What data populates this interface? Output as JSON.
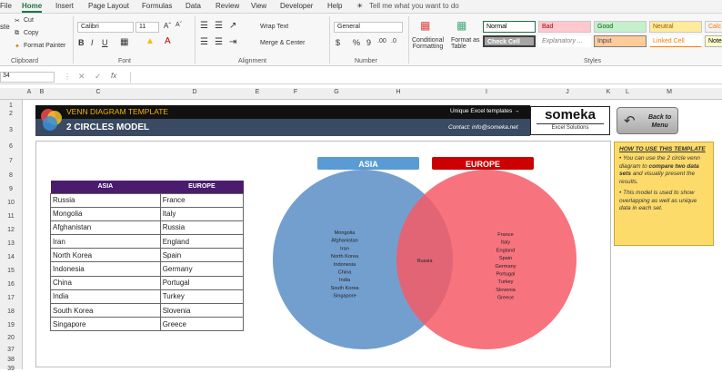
{
  "ribbon": {
    "tabs": [
      "File",
      "Home",
      "Insert",
      "Page Layout",
      "Formulas",
      "Data",
      "Review",
      "View",
      "Developer",
      "Help"
    ],
    "tell_me": "Tell me what you want to do",
    "clipboard": {
      "cut": "Cut",
      "copy": "Copy",
      "format_painter": "Format Painter",
      "paste": "ste",
      "label": "Clipboard"
    },
    "font": {
      "name": "Calibri",
      "size": "11",
      "label": "Font"
    },
    "alignment": {
      "wrap": "Wrap Text",
      "merge": "Merge & Center",
      "label": "Alignment"
    },
    "number": {
      "format": "General",
      "label": "Number"
    },
    "styles": {
      "conditional": "Conditional\nFormatting",
      "format_as": "Format as\nTable",
      "label": "Styles",
      "cells": [
        {
          "label": "Normal",
          "bg": "#ffffff",
          "fg": "#000000"
        },
        {
          "label": "Bad",
          "bg": "#ffc7ce",
          "fg": "#9c0006"
        },
        {
          "label": "Good",
          "bg": "#c6efce",
          "fg": "#006100"
        },
        {
          "label": "Neutral",
          "bg": "#ffeb9c",
          "fg": "#9c5700"
        },
        {
          "label": "Calc",
          "bg": "#f2f2f2",
          "fg": "#fa7d00"
        },
        {
          "label": "Check Cell",
          "bg": "#a5a5a5",
          "fg": "#ffffff"
        },
        {
          "label": "Explanatory ...",
          "bg": "#ffffff",
          "fg": "#7f7f7f"
        },
        {
          "label": "Input",
          "bg": "#ffcc99",
          "fg": "#3f3f76"
        },
        {
          "label": "Linked Cell",
          "bg": "#ffffff",
          "fg": "#fa7d00"
        },
        {
          "label": "Note",
          "bg": "#ffffcc",
          "fg": "#000000"
        }
      ]
    }
  },
  "formula_bar": {
    "name_box": "34",
    "value": ""
  },
  "columns": [
    "A",
    "B",
    "C",
    "D",
    "E",
    "F",
    "G",
    "H",
    "I",
    "J",
    "K",
    "L",
    "M"
  ],
  "rows": [
    "1",
    "2",
    "3",
    "6",
    "7",
    "8",
    "9",
    "10",
    "11",
    "12",
    "13",
    "14",
    "15",
    "16",
    "17",
    "18",
    "19",
    "20",
    "37",
    "38",
    "39"
  ],
  "banner": {
    "title": "VENN DIAGRAM TEMPLATE",
    "subtitle": "2 CIRCLES MODEL",
    "unique": "Unique Excel templates →",
    "contact": "Contact: info@someka.net",
    "logo_name": "someka",
    "logo_sub": "Excel Solutions",
    "back": "Back to\nMenu"
  },
  "howto": {
    "title": "HOW TO USE THIS TEMPLATE",
    "p1a": "You can use the 2 circle venn diagram to ",
    "p1b": "compare two data sets",
    "p1c": " and visually present the results.",
    "p2": "This model is used to show overlapping as well as unique data in each set."
  },
  "table": {
    "headers": [
      "ASIA",
      "EUROPE"
    ],
    "rows": [
      [
        "Russia",
        "France"
      ],
      [
        "Mongolia",
        "Italy"
      ],
      [
        "Afghanistan",
        "Russia"
      ],
      [
        "Iran",
        "England"
      ],
      [
        "North Korea",
        "Spain"
      ],
      [
        "Indonesia",
        "Germany"
      ],
      [
        "China",
        "Portugal"
      ],
      [
        "India",
        "Turkey"
      ],
      [
        "South Korea",
        "Slovenia"
      ],
      [
        "Singapore",
        "Greece"
      ]
    ]
  },
  "venn": {
    "left_label": "ASIA",
    "right_label": "EUROPE",
    "left_only": [
      "Mongolia",
      "Afghanistan",
      "Iran",
      "North Korea",
      "Indonesia",
      "China",
      "India",
      "South Korea",
      "Singapore"
    ],
    "overlap": [
      "Russia"
    ],
    "right_only": [
      "France",
      "Italy",
      "England",
      "Spain",
      "Germany",
      "Portugal",
      "Turkey",
      "Slovenia",
      "Greece"
    ],
    "colors": {
      "left": "#5b8ec7",
      "right": "#f65b66",
      "left_label_bg": "#5b9bd5",
      "right_label_bg": "#cc0000"
    }
  }
}
